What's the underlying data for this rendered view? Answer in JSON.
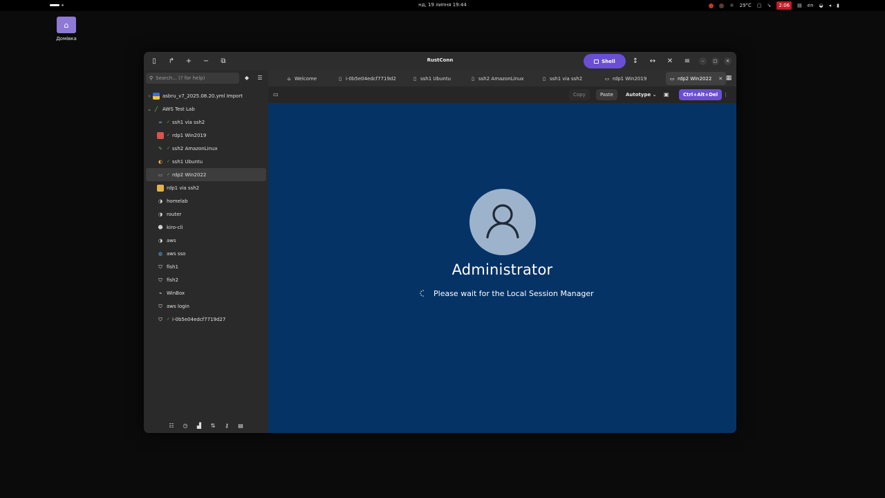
{
  "topbar": {
    "clock": "нд, 19 липня  19:44",
    "weather": "29°C",
    "badge": "2:06",
    "lang": "en"
  },
  "desktop": {
    "home_label": "Домівка"
  },
  "window": {
    "title": "RustConn",
    "shell_label": "Shell"
  },
  "sidebar": {
    "search_placeholder": "Search... (? for help)",
    "items": [
      {
        "label": "asbru_v7_2025.08.20.yml Import"
      },
      {
        "label": "AWS Test Lab"
      },
      {
        "label": "ssh1 via ssh2"
      },
      {
        "label": "rdp1 Win2019"
      },
      {
        "label": "ssh2 AmazonLinux"
      },
      {
        "label": "ssh1 Ubuntu"
      },
      {
        "label": "rdp2 Win2022"
      },
      {
        "label": "rdp1 via ssh2"
      },
      {
        "label": "homelab"
      },
      {
        "label": "router"
      },
      {
        "label": "kiro-cli"
      },
      {
        "label": "aws"
      },
      {
        "label": "aws sso"
      },
      {
        "label": "fish1"
      },
      {
        "label": "fish2"
      },
      {
        "label": "WinBox"
      },
      {
        "label": "aws login"
      },
      {
        "label": "i-0b5e04edcf7719d27"
      }
    ]
  },
  "tabs": [
    {
      "label": "Welcome"
    },
    {
      "label": "i-0b5e04edcf7719d2"
    },
    {
      "label": "ssh1 Ubuntu"
    },
    {
      "label": "ssh2 AmazonLinux"
    },
    {
      "label": "ssh1 via ssh2"
    },
    {
      "label": "rdp1 Win2019"
    },
    {
      "label": "rdp2 Win2022"
    }
  ],
  "toolbar": {
    "copy": "Copy",
    "paste": "Paste",
    "autotype": "Autotype",
    "cad": "Ctrl+Alt+Del"
  },
  "remote": {
    "user": "Administrator",
    "message": "Please wait for the Local Session Manager"
  }
}
